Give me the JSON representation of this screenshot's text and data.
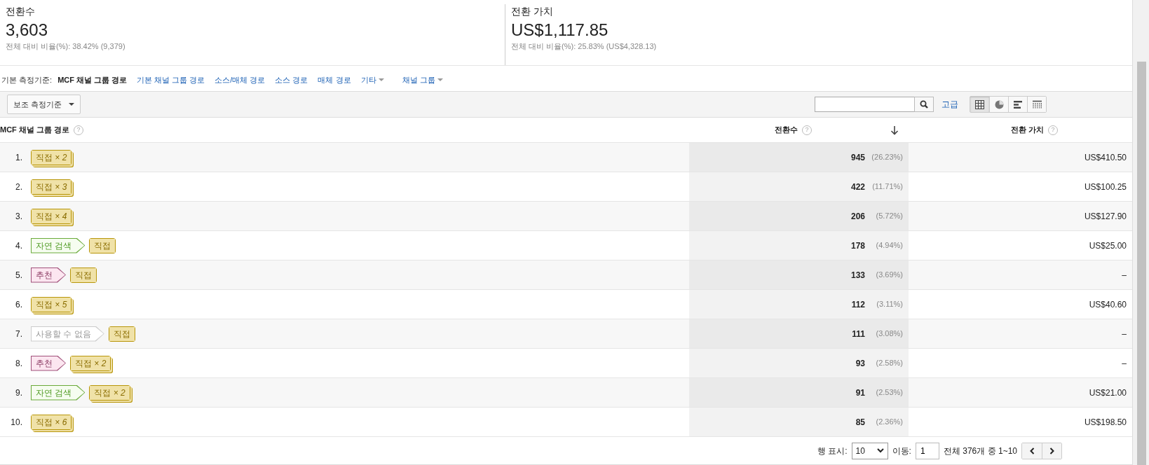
{
  "metrics": [
    {
      "title": "전환수",
      "value": "3,603",
      "note": "전체 대비 비율(%): 38.42% (9,379)"
    },
    {
      "title": "전환 가치",
      "value": "US$1,117.85",
      "note": "전체 대비 비율(%): 25.83% (US$4,328.13)"
    }
  ],
  "dimension_bar": {
    "label": "기본 측정기준:",
    "tabs": [
      {
        "label": "MCF 채널 그룹 경로",
        "selected": true,
        "kind": "link"
      },
      {
        "label": "기본 채널 그룹 경로",
        "selected": false,
        "kind": "link"
      },
      {
        "label": "소스/매체 경로",
        "selected": false,
        "kind": "link"
      },
      {
        "label": "소스 경로",
        "selected": false,
        "kind": "link"
      },
      {
        "label": "매체 경로",
        "selected": false,
        "kind": "link"
      },
      {
        "label": "기타",
        "selected": false,
        "kind": "dropdown"
      },
      {
        "label": "채널 그룹",
        "selected": false,
        "kind": "dropdown"
      }
    ]
  },
  "toolbar": {
    "secondary_dimension": "보조 측정기준",
    "advanced_link": "고급",
    "views": [
      {
        "kind": "table",
        "selected": true
      },
      {
        "kind": "pie",
        "selected": false
      },
      {
        "kind": "bar",
        "selected": false
      },
      {
        "kind": "pivot",
        "selected": false
      }
    ]
  },
  "table": {
    "columns": [
      {
        "label": "MCF 채널 그룹 경로",
        "help": "?",
        "sorted": false
      },
      {
        "label": "전환수",
        "help": "?",
        "sorted": true
      },
      {
        "label": "전환 가치",
        "help": "?",
        "sorted": false
      }
    ],
    "rows": [
      {
        "index": "1.",
        "path": [
          {
            "kind": "direct",
            "label": "직접 *× 2*",
            "stacked": true
          }
        ],
        "conversions": "945",
        "share": "(26.23%)",
        "value": "US$410.50"
      },
      {
        "index": "2.",
        "path": [
          {
            "kind": "direct",
            "label": "직접 *× 3*",
            "stacked": true
          }
        ],
        "conversions": "422",
        "share": "(11.71%)",
        "value": "US$100.25"
      },
      {
        "index": "3.",
        "path": [
          {
            "kind": "direct",
            "label": "직접 *× 4*",
            "stacked": true
          }
        ],
        "conversions": "206",
        "share": "(5.72%)",
        "value": "US$127.90"
      },
      {
        "index": "4.",
        "path": [
          {
            "kind": "organic",
            "label": "자연 검색",
            "stacked": false
          },
          {
            "kind": "direct",
            "label": "직접",
            "stacked": false
          }
        ],
        "conversions": "178",
        "share": "(4.94%)",
        "value": "US$25.00"
      },
      {
        "index": "5.",
        "path": [
          {
            "kind": "referral",
            "label": "추천",
            "stacked": false
          },
          {
            "kind": "direct",
            "label": "직접",
            "stacked": false
          }
        ],
        "conversions": "133",
        "share": "(3.69%)",
        "value": "–"
      },
      {
        "index": "6.",
        "path": [
          {
            "kind": "direct",
            "label": "직접 *× 5*",
            "stacked": true
          }
        ],
        "conversions": "112",
        "share": "(3.11%)",
        "value": "US$40.60"
      },
      {
        "index": "7.",
        "path": [
          {
            "kind": "unavailable",
            "label": "사용할 수 없음",
            "stacked": false
          },
          {
            "kind": "direct",
            "label": "직접",
            "stacked": false
          }
        ],
        "conversions": "111",
        "share": "(3.08%)",
        "value": "–"
      },
      {
        "index": "8.",
        "path": [
          {
            "kind": "referral",
            "label": "추천",
            "stacked": false
          },
          {
            "kind": "direct",
            "label": "직접 *× 2*",
            "stacked": true
          }
        ],
        "conversions": "93",
        "share": "(2.58%)",
        "value": "–"
      },
      {
        "index": "9.",
        "path": [
          {
            "kind": "organic",
            "label": "자연 검색",
            "stacked": false
          },
          {
            "kind": "direct",
            "label": "직접 *× 2*",
            "stacked": true
          }
        ],
        "conversions": "91",
        "share": "(2.53%)",
        "value": "US$21.00"
      },
      {
        "index": "10.",
        "path": [
          {
            "kind": "direct",
            "label": "직접 *× 6*",
            "stacked": true
          }
        ],
        "conversions": "85",
        "share": "(2.36%)",
        "value": "US$198.50"
      }
    ]
  },
  "pagination": {
    "rows_label": "행 표시:",
    "rows_value": "10",
    "goto_label": "이동:",
    "goto_value": "1",
    "range": "전체 376개 중 1~10"
  }
}
